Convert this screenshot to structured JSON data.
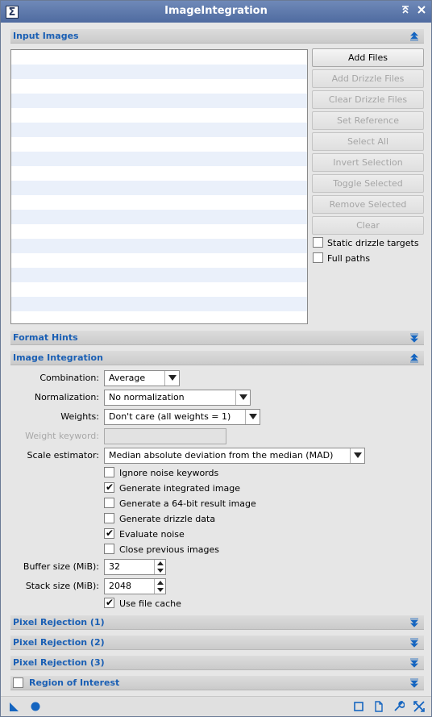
{
  "window": {
    "title": "ImageIntegration",
    "app_icon": "sigma-icon"
  },
  "sections": {
    "input_images": "Input Images",
    "format_hints": "Format Hints",
    "image_integration": "Image Integration",
    "pixel_rejection_1": "Pixel Rejection (1)",
    "pixel_rejection_2": "Pixel Rejection (2)",
    "pixel_rejection_3": "Pixel Rejection (3)",
    "region_of_interest": "Region of Interest"
  },
  "input_buttons": {
    "add_files": "Add Files",
    "add_drizzle_files": "Add Drizzle Files",
    "clear_drizzle_files": "Clear Drizzle Files",
    "set_reference": "Set Reference",
    "select_all": "Select All",
    "invert_selection": "Invert Selection",
    "toggle_selected": "Toggle Selected",
    "remove_selected": "Remove Selected",
    "clear": "Clear"
  },
  "input_options": {
    "static_drizzle_targets": "Static drizzle targets",
    "full_paths": "Full paths"
  },
  "integration": {
    "combination_label": "Combination:",
    "combination_value": "Average",
    "normalization_label": "Normalization:",
    "normalization_value": "No normalization",
    "weights_label": "Weights:",
    "weights_value": "Don't care (all weights = 1)",
    "weight_keyword_label": "Weight keyword:",
    "weight_keyword_value": "",
    "scale_estimator_label": "Scale estimator:",
    "scale_estimator_value": "Median absolute deviation from the median (MAD)",
    "ignore_noise_keywords": "Ignore noise keywords",
    "generate_integrated_image": "Generate integrated image",
    "generate_64bit": "Generate a 64-bit result image",
    "generate_drizzle_data": "Generate drizzle data",
    "evaluate_noise": "Evaluate noise",
    "close_previous_images": "Close previous images",
    "buffer_size_label": "Buffer size (MiB):",
    "buffer_size_value": "32",
    "stack_size_label": "Stack size (MiB):",
    "stack_size_value": "2048",
    "use_file_cache": "Use file cache"
  },
  "colors": {
    "section_label": "#1a5fb4",
    "title_bar": "#5a75a8",
    "accent_icon": "#1565c0"
  }
}
